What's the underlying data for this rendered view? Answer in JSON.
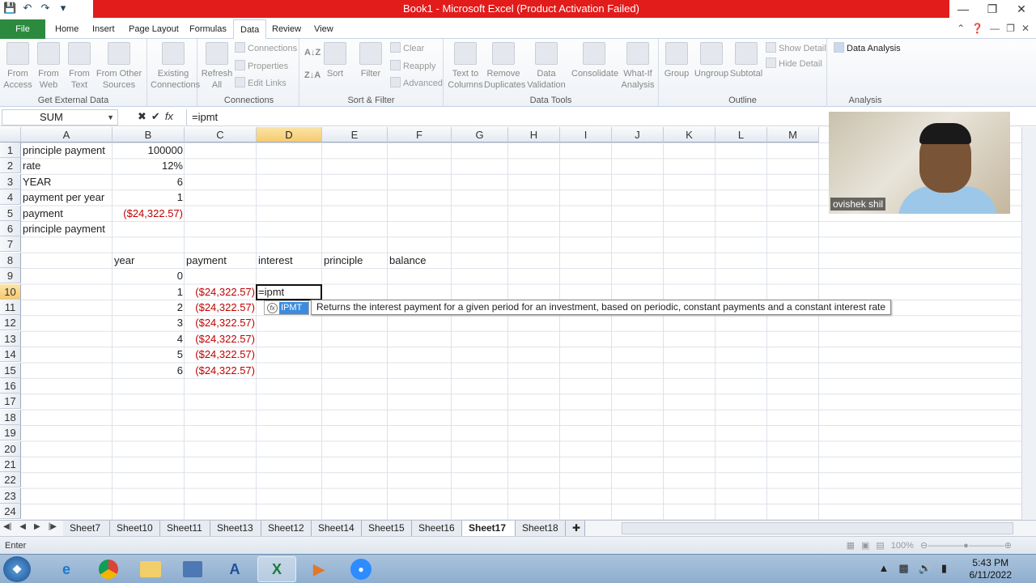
{
  "window": {
    "title": "Book1 - Microsoft Excel (Product Activation Failed)"
  },
  "ribbon_tabs": [
    "File",
    "Home",
    "Insert",
    "Page Layout",
    "Formulas",
    "Data",
    "Review",
    "View"
  ],
  "ribbon": {
    "get_external": {
      "label": "Get External Data",
      "buttons": [
        "From Access",
        "From Web",
        "From Text",
        "From Other Sources"
      ],
      "existing": "Existing Connections"
    },
    "connections": {
      "label": "Connections",
      "refresh": "Refresh All",
      "items": [
        "Connections",
        "Properties",
        "Edit Links"
      ]
    },
    "sort_filter": {
      "label": "Sort & Filter",
      "sort": "Sort",
      "filter": "Filter",
      "items": [
        "Clear",
        "Reapply",
        "Advanced"
      ]
    },
    "data_tools": {
      "label": "Data Tools",
      "buttons": [
        "Text to Columns",
        "Remove Duplicates",
        "Data Validation",
        "Consolidate",
        "What-If Analysis"
      ]
    },
    "outline": {
      "label": "Outline",
      "buttons": [
        "Group",
        "Ungroup",
        "Subtotal"
      ],
      "items": [
        "Show Detail",
        "Hide Detail"
      ]
    },
    "analysis": {
      "label": "Analysis",
      "data_analysis": "Data Analysis"
    }
  },
  "formula_bar": {
    "name_box": "SUM",
    "formula": "=ipmt"
  },
  "columns": [
    "A",
    "B",
    "C",
    "D",
    "E",
    "F",
    "G",
    "H",
    "I",
    "J",
    "K",
    "L",
    "M"
  ],
  "rows": [
    "1",
    "2",
    "3",
    "4",
    "5",
    "6",
    "7",
    "8",
    "9",
    "10",
    "11",
    "12",
    "13",
    "14",
    "15",
    "16",
    "17",
    "18",
    "19",
    "20",
    "21",
    "22",
    "23",
    "24"
  ],
  "cells": {
    "A1": "principle payment",
    "B1": "100000",
    "A2": "rate",
    "B2": "12%",
    "A3": "YEAR",
    "B3": "6",
    "A4": "payment per year",
    "B4": "1",
    "A5": "payment",
    "B5": "($24,322.57)",
    "A6": "principle payment",
    "B8": "year",
    "C8": "payment",
    "D8": "interest",
    "E8": "principle",
    "F8": "balance",
    "B9": "0",
    "B10": "1",
    "C10": "($24,322.57)",
    "D10": "=ipmt",
    "B11": "2",
    "C11": "($24,322.57)",
    "B12": "3",
    "C12": "($24,322.57)",
    "B13": "4",
    "C13": "($24,322.57)",
    "B14": "5",
    "C14": "($24,322.57)",
    "B15": "6",
    "C15": "($24,322.57)"
  },
  "autocomplete": {
    "function": "IPMT",
    "tooltip": "Returns the interest payment for a given period for an investment, based on periodic, constant payments and a constant interest rate"
  },
  "sheets": [
    "Sheet7",
    "Sheet10",
    "Sheet11",
    "Sheet13",
    "Sheet12",
    "Sheet14",
    "Sheet15",
    "Sheet16",
    "Sheet17",
    "Sheet18"
  ],
  "active_sheet": "Sheet17",
  "status": {
    "mode": "Enter",
    "zoom": "100%"
  },
  "webcam": {
    "name": "ovishek shil"
  },
  "taskbar": {
    "time": "5:43 PM",
    "date": "6/11/2022"
  },
  "colors": {
    "file_tab": "#2c8a3f",
    "title_bar": "#e21b1b",
    "negative": "#c00000"
  }
}
